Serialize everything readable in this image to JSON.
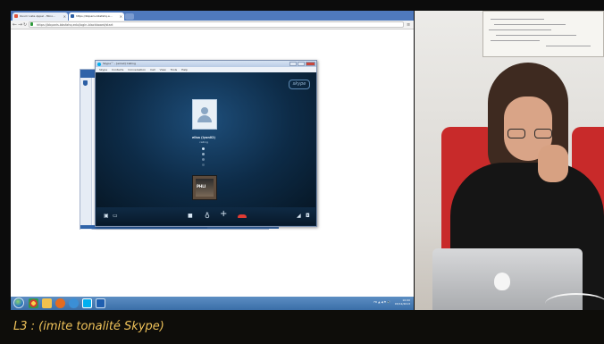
{
  "browser": {
    "tabs": [
      {
        "label": "Ouvrir Liste Appel - Mino…",
        "icon": "browser-tab-icon"
      },
      {
        "label": "https://bbparis.bbsfahq.a…",
        "icon": "browser-tab-icon"
      }
    ],
    "url": "https://bbparis.bbsfahq.edu/login-blackboard/start"
  },
  "skype": {
    "window_title": "Skype™ - [email] Calling",
    "menu": [
      "Skype",
      "Contacts",
      "Conversation",
      "Call",
      "View",
      "Tools",
      "Help"
    ],
    "brand": "skype",
    "contact_name": "elisa (lyon02)",
    "call_status": "calling",
    "preview_label": "PHLI",
    "icons": [
      "dialpad-icon",
      "chat-icon",
      "video-icon",
      "microphone-icon",
      "add-icon",
      "hang-up-icon",
      "signal-icon",
      "settings-icon"
    ]
  },
  "taskbar": {
    "apps": [
      "start-orb-icon",
      "chrome-icon",
      "folder-icon",
      "media-icon",
      "ie-icon",
      "skype-icon",
      "outlook-icon"
    ],
    "tray": "FR ▲ ◀ ⚑ 🔊",
    "time": "10:00",
    "date": "03/12/2013"
  },
  "subtitle": "L3 : (imite tonalité Skype)"
}
